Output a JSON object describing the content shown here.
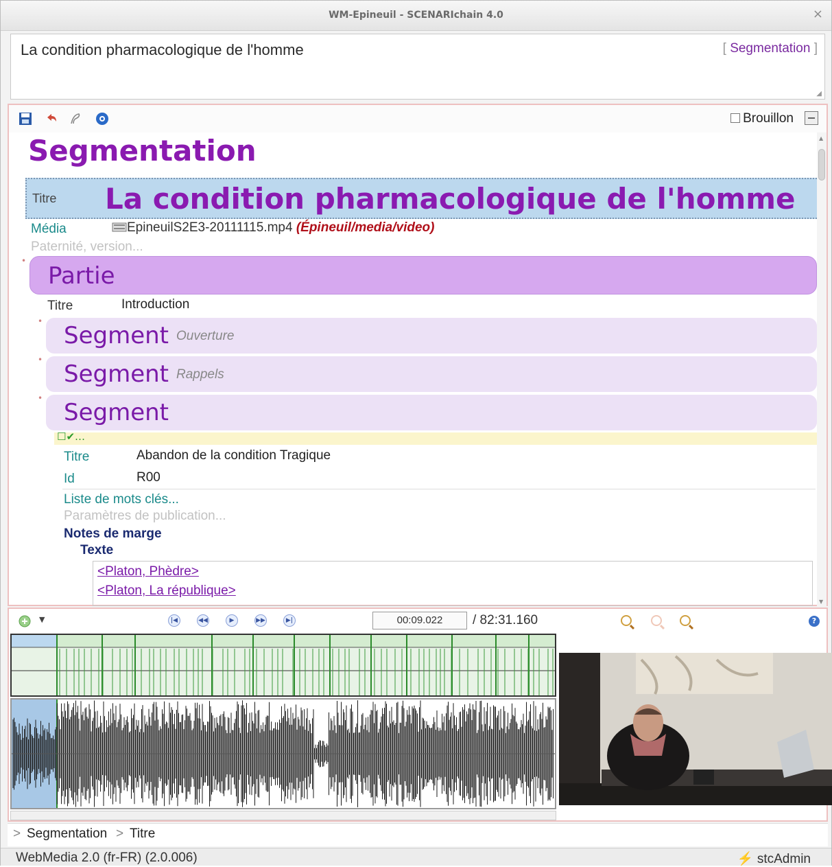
{
  "window": {
    "title": "WM-Epineuil - SCENARIchain 4.0",
    "close_glyph": "×"
  },
  "header": {
    "document_title": "La condition pharmacologique de l'homme",
    "model_label": "Segmentation"
  },
  "toolbar": {
    "draft_label": "Brouillon"
  },
  "doc": {
    "heading": "Segmentation",
    "titre_label": "Titre",
    "titre_value": "La condition pharmacologique de l'homme",
    "media_label": "Média",
    "media_file": "EpineuilS2E3-20111115.mp4",
    "media_path": "(Épineuil/media/video)",
    "paternite": "Paternité, version...",
    "partie": {
      "label": "Partie",
      "titre_label": "Titre",
      "titre_value": "Introduction",
      "segments": [
        {
          "label": "Segment",
          "subtitle": "Ouverture"
        },
        {
          "label": "Segment",
          "subtitle": "Rappels"
        },
        {
          "label": "Segment",
          "subtitle": ""
        }
      ]
    },
    "segment_detail": {
      "titre_label": "Titre",
      "titre_value": "Abandon de la condition Tragique",
      "id_label": "Id",
      "id_value": "R00",
      "keywords": "Liste de mots clés...",
      "publication": "Paramètres de publication...",
      "notes_label": "Notes de marge",
      "texte_label": "Texte",
      "links": [
        "<Platon, Phèdre>",
        "<Platon, La république>"
      ]
    }
  },
  "player": {
    "current_time": "00:09.022",
    "duration": "/ 82:31.160"
  },
  "breadcrumb": {
    "items": [
      "Segmentation",
      "Titre"
    ]
  },
  "status": {
    "left": "WebMedia 2.0 (fr-FR) (2.0.006)",
    "user": "stcAdmin"
  },
  "colors": {
    "accent": "#8a1ab0",
    "title_bg": "#bcd8ee",
    "partie_bg": "#d6a8ef",
    "segment_bg": "#ece1f6",
    "frame_border": "#eec0c0"
  }
}
